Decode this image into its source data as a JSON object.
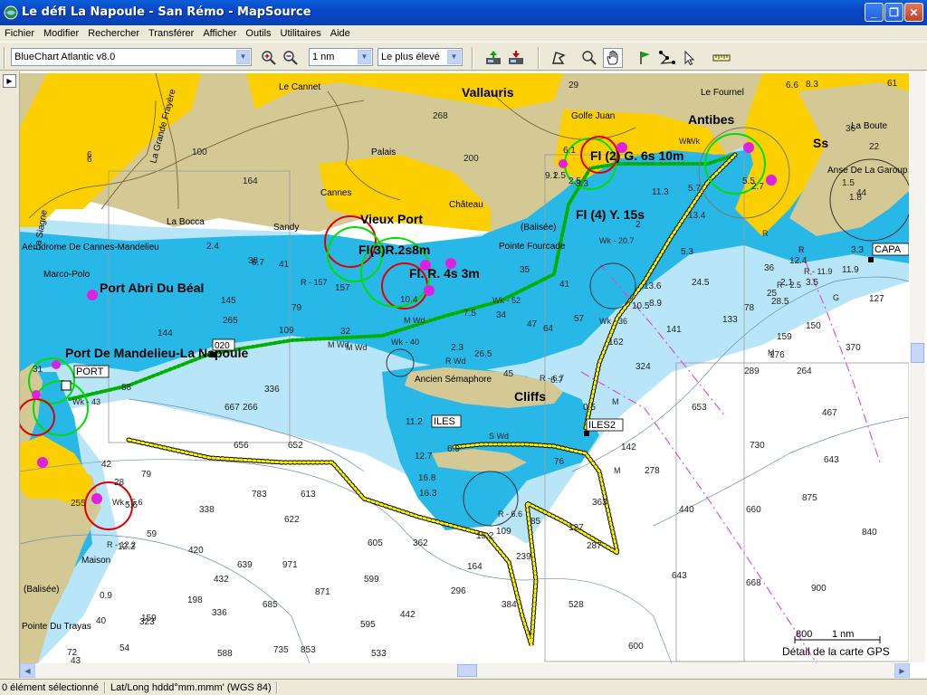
{
  "window": {
    "title": "Le défi La Napoule - San Rémo - MapSource",
    "minimize_label": "_",
    "restore_label": "❐",
    "close_label": "✕"
  },
  "menu": [
    {
      "label": "Fichier"
    },
    {
      "label": "Modifier"
    },
    {
      "label": "Rechercher"
    },
    {
      "label": "Transférer"
    },
    {
      "label": "Afficher"
    },
    {
      "label": "Outils"
    },
    {
      "label": "Utilitaires"
    },
    {
      "label": "Aide"
    }
  ],
  "toolbar": {
    "map_product": "BlueChart Atlantic v8.0",
    "zoom_scale": "1 nm",
    "detail_level": "Le plus élevé",
    "icons": [
      "zoom-in-icon",
      "zoom-out-icon",
      "send-to-device-icon",
      "receive-from-device-icon",
      "select-tool-icon",
      "zoom-tool-icon",
      "pan-hand-icon",
      "waypoint-flag-icon",
      "route-tool-icon",
      "pointer-tool-icon",
      "measure-tool-icon"
    ]
  },
  "colors": {
    "land": "#fcd000",
    "land_relief": "#d2c796",
    "deep_water": "#ffffff",
    "shallow_water": "#22b8e6",
    "mid_water": "#8fd6f0",
    "track_green": "#00c000",
    "track_yellow": "#f8f200",
    "light_green": "#00dd00",
    "light_red": "#e00000",
    "buoy_magenta": "#e020e0",
    "titlebar_blue": "#0842b4"
  },
  "map": {
    "places": {
      "vallauris": "Vallauris",
      "antibes": "Antibes",
      "vieux_port": "Vieux Port",
      "port_abri": "Port Abri Du Béal",
      "port_mandelieu": "Port De Mandelieu-La Napoule",
      "cliffs": "Cliffs",
      "le_cannet": "Le Cannet",
      "palais": "Palais",
      "cannes": "Cannes",
      "la_bocca": "La Bocca",
      "sandy": "Sandy",
      "chateau": "Château",
      "golfe_juan": "Golfe Juan",
      "le_fournel": "Le Fournel",
      "la_boute": "La Boute",
      "anse_garoupe": "Anse De La Garoup",
      "aerodrome": "Aérodrome De Cannes-Mandelieu",
      "marco_polo": "Marco-Polo",
      "la_siagne": "La Siagne",
      "grande_frayere": "La Grande Frayère",
      "pointe_fourcade": "Pointe Fourcade",
      "balisee_1": "(Balisée)",
      "balisee_2": "(Balisée)",
      "maison": "Maison",
      "pointe_trayas": "Pointe Du Trayas",
      "ancien_semaphore": "Ancien Sémaphore",
      "ss": "Ss"
    },
    "lights": {
      "fl2": "Fl (2) G. 6s 10m",
      "fl4": "Fl (4) Y. 15s",
      "fl3": "Fl(3)R.2s8m",
      "flr": "Fl. R. 4s 3m"
    },
    "waypoints": {
      "port": "PORT",
      "iles": "ILES",
      "iles2": "ILES2",
      "capa": "CAPA",
      "wp020": "020"
    },
    "depths": [
      {
        "v": "29"
      },
      {
        "v": "268"
      },
      {
        "v": "200"
      },
      {
        "v": "164"
      },
      {
        "v": "6"
      },
      {
        "v": "100"
      },
      {
        "v": "145"
      },
      {
        "v": "265"
      },
      {
        "v": "79"
      },
      {
        "v": "109"
      },
      {
        "v": "144"
      },
      {
        "v": "157"
      },
      {
        "v": "336"
      },
      {
        "v": "266"
      },
      {
        "v": "667"
      },
      {
        "v": "656"
      },
      {
        "v": "652"
      },
      {
        "v": "783"
      },
      {
        "v": "613"
      },
      {
        "v": "622"
      },
      {
        "v": "338"
      },
      {
        "v": "420"
      },
      {
        "v": "639"
      },
      {
        "v": "971"
      },
      {
        "v": "605"
      },
      {
        "v": "599"
      },
      {
        "v": "362"
      },
      {
        "v": "296"
      },
      {
        "v": "432"
      },
      {
        "v": "685"
      },
      {
        "v": "871"
      },
      {
        "v": "595"
      },
      {
        "v": "442"
      },
      {
        "v": "384"
      },
      {
        "v": "528"
      },
      {
        "v": "588"
      },
      {
        "v": "735"
      },
      {
        "v": "853"
      },
      {
        "v": "533"
      },
      {
        "v": "600"
      },
      {
        "v": "643"
      },
      {
        "v": "440"
      },
      {
        "v": "660"
      },
      {
        "v": "668"
      },
      {
        "v": "900"
      },
      {
        "v": "875"
      },
      {
        "v": "840"
      },
      {
        "v": "730"
      },
      {
        "v": "643"
      },
      {
        "v": "467"
      },
      {
        "v": "653"
      },
      {
        "v": "289"
      },
      {
        "v": "264"
      },
      {
        "v": "370"
      },
      {
        "v": "176"
      },
      {
        "v": "159"
      },
      {
        "v": "150"
      },
      {
        "v": "141"
      },
      {
        "v": "133"
      },
      {
        "v": "127"
      },
      {
        "v": "324"
      },
      {
        "v": "162"
      },
      {
        "v": "278"
      },
      {
        "v": "142"
      },
      {
        "v": "363"
      },
      {
        "v": "287"
      },
      {
        "v": "127"
      },
      {
        "v": "85"
      },
      {
        "v": "239"
      },
      {
        "v": "164"
      },
      {
        "v": "109"
      },
      {
        "v": "323"
      },
      {
        "v": "159"
      },
      {
        "v": "198"
      },
      {
        "v": "336"
      },
      {
        "v": "59"
      },
      {
        "v": "79"
      },
      {
        "v": "42"
      },
      {
        "v": "28"
      },
      {
        "v": "255"
      },
      {
        "v": "54"
      },
      {
        "v": "40"
      },
      {
        "v": "43"
      },
      {
        "v": "72"
      },
      {
        "v": "61"
      },
      {
        "v": "8.3"
      },
      {
        "v": "36"
      },
      {
        "v": "44"
      },
      {
        "v": "22"
      },
      {
        "v": "3.3"
      },
      {
        "v": "11.9"
      },
      {
        "v": "28.5"
      },
      {
        "v": "24.5"
      },
      {
        "v": "13.6"
      },
      {
        "v": "8.9"
      },
      {
        "v": "11.3"
      },
      {
        "v": "57"
      },
      {
        "v": "64"
      },
      {
        "v": "47"
      },
      {
        "v": "26.5"
      },
      {
        "v": "45"
      },
      {
        "v": "34"
      },
      {
        "v": "35"
      },
      {
        "v": "41"
      },
      {
        "v": "7.5"
      },
      {
        "v": "10.4"
      },
      {
        "v": "32"
      },
      {
        "v": "38"
      },
      {
        "v": "6.7"
      },
      {
        "v": "2.4"
      },
      {
        "v": "41"
      },
      {
        "v": "25"
      },
      {
        "v": "36"
      },
      {
        "v": "1.5"
      },
      {
        "v": "13.4"
      },
      {
        "v": "5.3"
      },
      {
        "v": "10.5"
      },
      {
        "v": "5.7"
      },
      {
        "v": "11.2"
      },
      {
        "v": "12.7"
      },
      {
        "v": "16.8"
      },
      {
        "v": "16.3"
      },
      {
        "v": "15.2"
      },
      {
        "v": "6.9"
      },
      {
        "v": "76"
      },
      {
        "v": "0.5"
      },
      {
        "v": "6.7"
      },
      {
        "v": "5.6"
      },
      {
        "v": "12.2"
      },
      {
        "v": "0.9"
      },
      {
        "v": "88"
      },
      {
        "v": "2.3"
      },
      {
        "v": "6.1"
      },
      {
        "v": "2.5"
      },
      {
        "v": "3.3"
      },
      {
        "v": "9.1"
      },
      {
        "v": "2.7"
      },
      {
        "v": "31"
      },
      {
        "v": "5.5"
      },
      {
        "v": "1.8"
      },
      {
        "v": "12.4"
      },
      {
        "v": "2.1"
      },
      {
        "v": "3.5"
      },
      {
        "v": "78"
      },
      {
        "v": "6.6"
      },
      {
        "v": "2.5"
      },
      {
        "v": "6"
      },
      {
        "v": "2"
      }
    ],
    "small_labels": [
      {
        "t": "Wk - 43"
      },
      {
        "t": "Wk - 52"
      },
      {
        "t": "Wk - 20.7"
      },
      {
        "t": "M Wd"
      },
      {
        "t": "M Wd"
      },
      {
        "t": "Wk"
      },
      {
        "t": "S Wd"
      },
      {
        "t": "R Wd"
      },
      {
        "t": "R - 6.7"
      },
      {
        "t": "R - 6.6"
      },
      {
        "t": "R - 12.2"
      },
      {
        "t": "R - 157"
      },
      {
        "t": "Wk - 5.6"
      },
      {
        "t": "Wk"
      },
      {
        "t": "M"
      },
      {
        "t": "M"
      },
      {
        "t": "M"
      },
      {
        "t": "G"
      },
      {
        "t": "R"
      },
      {
        "t": "R"
      },
      {
        "t": "Wk - 36"
      },
      {
        "t": "Wk - 40"
      },
      {
        "t": "M Wd"
      },
      {
        "t": "R - 11.9"
      },
      {
        "t": "R - 2.5"
      }
    ],
    "scale_bar_value": "800",
    "scale_bar_unit": "1 nm",
    "detail_caption": "Détail de la carte GPS"
  },
  "status": {
    "selection": "0 élément sélectionné",
    "coord_format": "Lat/Long hddd°mm.mmm' (WGS 84)"
  }
}
